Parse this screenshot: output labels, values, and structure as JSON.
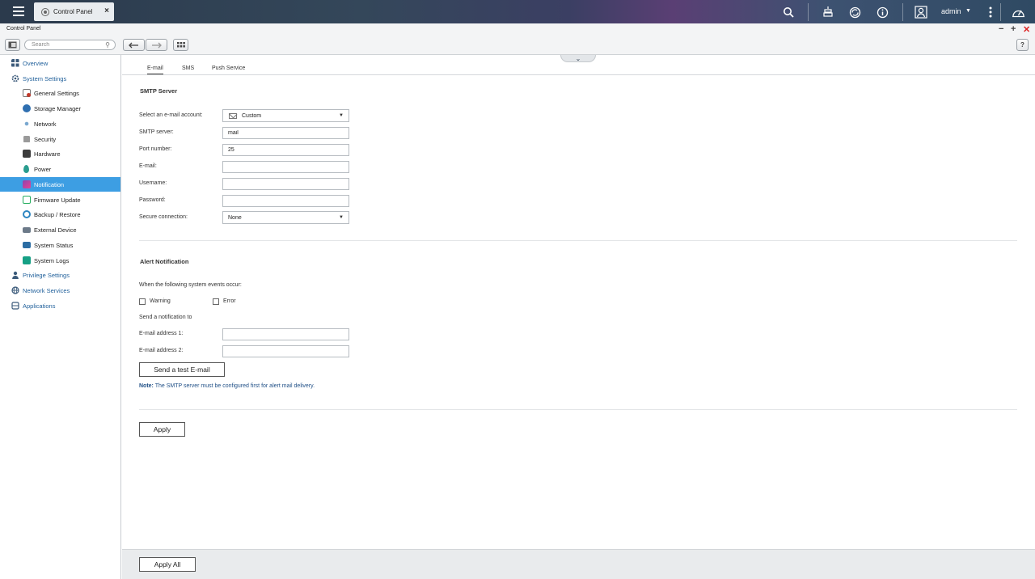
{
  "topbar": {
    "tab_label": "Control Panel",
    "tab_close": "×",
    "user": "admin"
  },
  "window": {
    "title": "Control Panel"
  },
  "toolbar": {
    "search_placeholder": "Search"
  },
  "sidebar": {
    "overview": "Overview",
    "system_settings": "System Settings",
    "items": [
      {
        "label": "General Settings",
        "color": "#c0392b"
      },
      {
        "label": "Storage Manager",
        "color": "#2f6fb0"
      },
      {
        "label": "Network",
        "color": "#4a7aa8"
      },
      {
        "label": "Security",
        "color": "#8a8a8a"
      },
      {
        "label": "Hardware",
        "color": "#3c3c3c"
      },
      {
        "label": "Power",
        "color": "#2a9d8f"
      },
      {
        "label": "Notification",
        "color": "#8e44ad"
      },
      {
        "label": "Firmware Update",
        "color": "#27ae60"
      },
      {
        "label": "Backup / Restore",
        "color": "#2e86c1"
      },
      {
        "label": "External Device",
        "color": "#555555"
      },
      {
        "label": "System Status",
        "color": "#2c6da3"
      },
      {
        "label": "System Logs",
        "color": "#16a085"
      }
    ],
    "privilege_settings": "Privilege Settings",
    "network_services": "Network Services",
    "applications": "Applications"
  },
  "tabs": [
    {
      "label": "E-mail",
      "active": true
    },
    {
      "label": "SMS",
      "active": false
    },
    {
      "label": "Push Service",
      "active": false
    }
  ],
  "smtp": {
    "title": "SMTP Server",
    "account_label": "Select an e-mail account:",
    "account_value": "Custom",
    "server_label": "SMTP server:",
    "server_value": "mail",
    "port_label": "Port number:",
    "port_value": "25",
    "email_label": "E-mail:",
    "email_value": "",
    "username_label": "Username:",
    "username_value": "",
    "password_label": "Password:",
    "password_value": "",
    "secure_label": "Secure connection:",
    "secure_value": "None"
  },
  "alert": {
    "title": "Alert Notification",
    "events_label": "When the following system events occur:",
    "warning_label": "Warning",
    "error_label": "Error",
    "send_to_label": "Send a notification to",
    "email1_label": "E-mail address 1:",
    "email1_value": "",
    "email2_label": "E-mail address 2:",
    "email2_value": "",
    "test_button": "Send a test E-mail",
    "note_prefix": "Note:",
    "note_text": " The SMTP server must be configured first for alert mail delivery."
  },
  "buttons": {
    "apply": "Apply",
    "apply_all": "Apply All"
  }
}
